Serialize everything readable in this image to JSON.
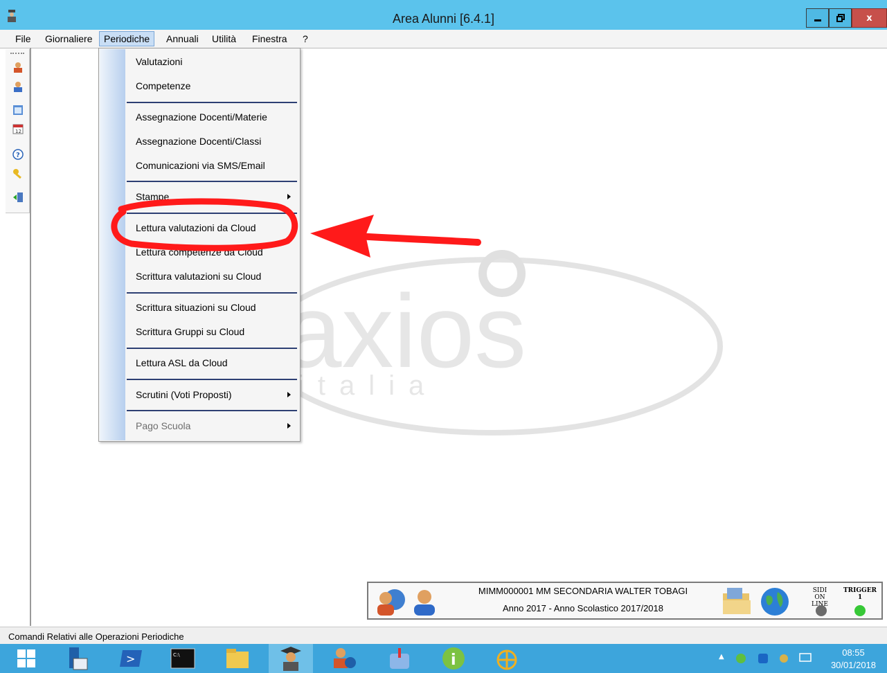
{
  "window": {
    "title": "Area Alunni [6.4.1]",
    "controls": {
      "minimize": "_",
      "maximize": "□",
      "close": "x"
    }
  },
  "menubar": {
    "items": [
      "File",
      "Giornaliere",
      "Periodiche",
      "Annuali",
      "Utilità",
      "Finestra",
      "?"
    ],
    "active": "Periodiche"
  },
  "dropdown": {
    "items": [
      {
        "label": "Valutazioni"
      },
      {
        "label": "Competenze"
      },
      {
        "label": "Assegnazione Docenti/Materie"
      },
      {
        "label": "Assegnazione Docenti/Classi"
      },
      {
        "label": "Comunicazioni via SMS/Email"
      },
      {
        "label": "Stampe"
      },
      {
        "label": "Lettura valutazioni da Cloud"
      },
      {
        "label": "Lettura competenze da Cloud"
      },
      {
        "label": "Scrittura valutazioni su Cloud"
      },
      {
        "label": "Scrittura situazioni su Cloud"
      },
      {
        "label": "Scrittura Gruppi su Cloud"
      },
      {
        "label": "Lettura ASL da Cloud"
      },
      {
        "label": "Scrutini (Voti Proposti)"
      },
      {
        "label": "Pago Scuola"
      }
    ]
  },
  "watermark": {
    "text": "axios",
    "subtext": "italia"
  },
  "infopanel": {
    "school": "MIMM000001 MM SECONDARIA WALTER TOBAGI",
    "year": "Anno 2017  -  Anno Scolastico 2017/2018",
    "sidi_label_1": "SIDI",
    "sidi_label_2": "ON LINE",
    "trigger_label": "TRIGGER",
    "trigger_value": "1",
    "sidi_color": "#6b6b6b",
    "trigger_color": "#37c837"
  },
  "statusbar": {
    "text": "Comandi Relativi alle Operazioni Periodiche"
  },
  "taskbar": {
    "time": "08:55",
    "date": "30/01/2018",
    "apps": [
      "windows-start",
      "server-manager",
      "powershell",
      "command-prompt",
      "file-explorer",
      "area-alunni",
      "user-manager",
      "mail-app",
      "info-app",
      "network-app"
    ]
  },
  "colors": {
    "titlebar": "#5bc3ec",
    "taskbar": "#3da5dc",
    "annotation": "#ff1a1a",
    "menu_separator": "#2d3f73"
  }
}
